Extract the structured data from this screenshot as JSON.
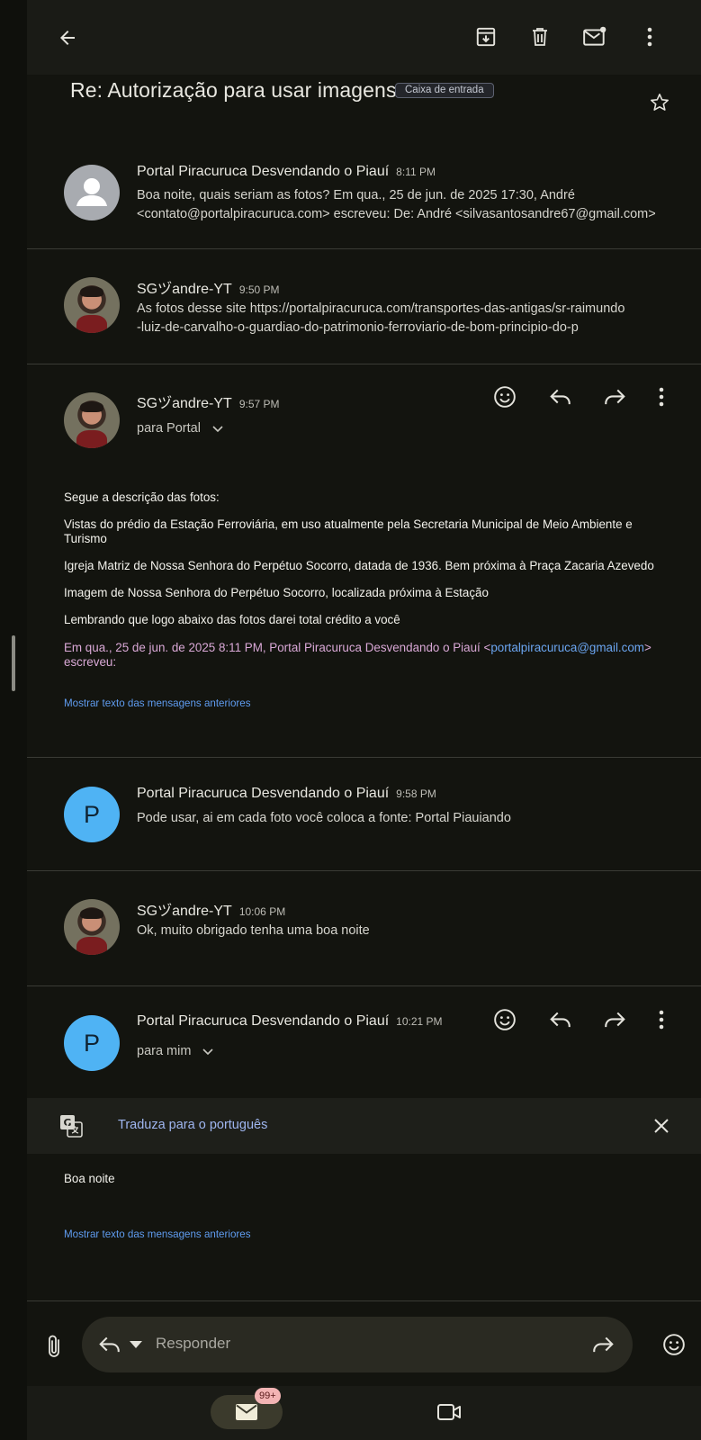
{
  "subject": "Re: Autorização para usar imagens",
  "label": "Caixa de entrada",
  "messages": [
    {
      "sender": "Portal Piracuruca Desvendando o Piauí",
      "time": "8:11 PM",
      "snippet_line1": "Boa noite, quais seriam as fotos? Em qua., 25 de jun. de 2025 17:30, André",
      "snippet_line2": "<contato@portalpiracuruca.com> escreveu: De: André <silvasantosandre67@gmail.com>"
    },
    {
      "sender": "SGヅandre-YT",
      "time": "9:50 PM",
      "snippet_line1": "As fotos desse site https://portalpiracuruca.com/transportes-das-antigas/sr-raimundo",
      "snippet_line2": "-luiz-de-carvalho-o-guardiao-do-patrimonio-ferroviario-de-bom-principio-do-p"
    },
    {
      "sender": "SGヅandre-YT",
      "time": "9:57 PM",
      "recipient": "para Portal",
      "body": [
        "Segue a descrição das fotos:",
        "Vistas do prédio da Estação Ferroviária, em uso atualmente pela Secretaria Municipal de Meio Ambiente e",
        "Turismo",
        "Igreja Matriz de Nossa Senhora do Perpétuo Socorro, datada de 1936. Bem próxima à Praça Zacaria Azevedo",
        "Imagem de Nossa Senhora do Perpétuo Socorro, localizada próxima à Estação",
        "Lembrando que logo abaixo das fotos darei total crédito a você"
      ],
      "quote_prefix": "Em qua., 25 de jun. de 2025 8:11 PM, Portal Piracuruca Desvendando o Piauí <",
      "quote_email": "portalpiracuruca@gmail.com",
      "quote_suffix": ">",
      "quote_line2": "escreveu:",
      "show_previous": "Mostrar texto das mensagens anteriores"
    },
    {
      "sender": "Portal Piracuruca Desvendando o Piauí",
      "time": "9:58 PM",
      "avatar_letter": "P",
      "snippet_line1": "Pode usar, ai em cada foto você coloca a fonte: Portal Piauiando"
    },
    {
      "sender": "SGヅandre-YT",
      "time": "10:06 PM",
      "snippet_line1": "Ok, muito obrigado tenha uma boa noite"
    },
    {
      "sender": "Portal Piracuruca Desvendando o Piauí",
      "time": "10:21 PM",
      "avatar_letter": "P",
      "recipient": "para mim",
      "translate": "Traduza para o português",
      "body": [
        "Boa noite"
      ],
      "show_previous": "Mostrar texto das mensagens anteriores"
    }
  ],
  "reply": {
    "placeholder": "Responder"
  },
  "nav": {
    "mail_badge": "99+"
  },
  "colors": {
    "background": "#13140f",
    "accent_blue": "#4fb3f4",
    "link": "#5f9cf0",
    "quote": "#d9a8d6"
  }
}
